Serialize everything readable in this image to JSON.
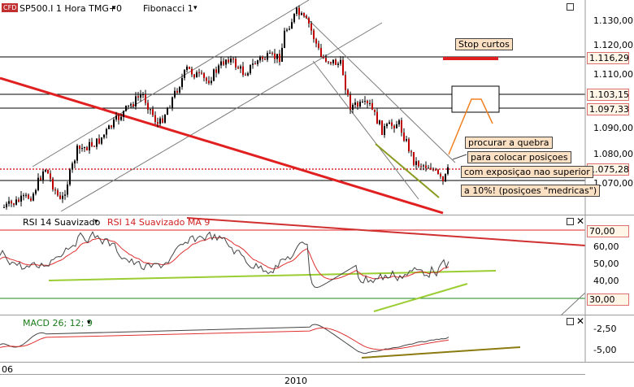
{
  "price_pane": {
    "logo": "CFD",
    "instrument": "SP500.I 1 Hora TMG+0",
    "tool": "Fibonacci 1",
    "axis_labels": [
      "1.130,00",
      "1.120,00",
      "1.110,00",
      "1.090,00",
      "1.080,00",
      "1.070,00"
    ],
    "level_boxes": [
      "1.116,29",
      "1.103,15",
      "1.097,33",
      "1.075,28"
    ],
    "stop_label": "Stop curtos",
    "notes": [
      "procurar a quebra",
      "para colocar posiçoes",
      "com exposiçao nao superior",
      "a 10%! (posiçoes \"medricas\")"
    ]
  },
  "rsi_pane": {
    "title": "RSI 14 Suavizado",
    "title_ma": "RSI 14 Suavizado MA 9",
    "axis_labels": [
      "60,00",
      "50,00",
      "40,00"
    ],
    "level_boxes": [
      "70,00",
      "30,00"
    ]
  },
  "macd_pane": {
    "title": "MACD 26; 12; 9",
    "axis_labels": [
      "-2,50",
      "-5,00"
    ]
  },
  "time_axis": {
    "left_label": "06",
    "year_label": "2010"
  },
  "colors": {
    "price_up": "#000000",
    "trendline_red": "#e02020",
    "channel_gray": "#7a7a7a",
    "olive_support": "#8a9a20",
    "green_support": "#9acd32",
    "orange_arrow": "#f08020",
    "rsi_line": "#444444",
    "rsi_ma": "#e03030"
  }
}
